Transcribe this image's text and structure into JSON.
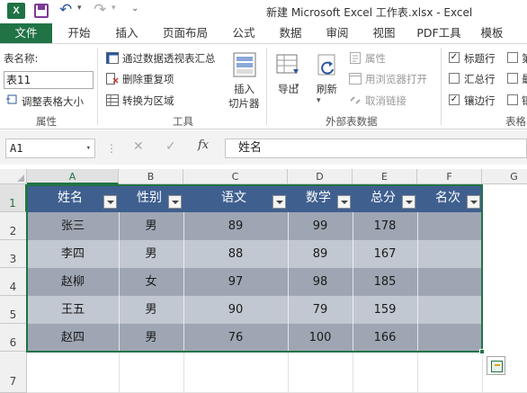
{
  "window": {
    "title": "新建 Microsoft Excel 工作表.xlsx - Excel",
    "app_logo": "X"
  },
  "quick_access": {
    "save_icon": "save-icon",
    "undo_glyph": "↶",
    "redo_glyph": "↷",
    "dropdown_glyph": "▾",
    "customize_glyph": "⌄"
  },
  "ribbon_tabs": [
    "文件",
    "开始",
    "插入",
    "页面布局",
    "公式",
    "数据",
    "审阅",
    "视图",
    "PDF工具",
    "模板"
  ],
  "ribbon": {
    "properties": {
      "table_name_label": "表名称:",
      "table_name_value": "表11",
      "resize_label": "调整表格大小",
      "group_label": "属性"
    },
    "tools": {
      "pivot_label": "通过数据透视表汇总",
      "remove_dup_label": "删除重复项",
      "convert_label": "转换为区域",
      "slicer_label_1": "插入",
      "slicer_label_2": "切片器",
      "group_label": "工具"
    },
    "external": {
      "export_label": "导出",
      "refresh_label": "刷新",
      "properties_label": "属性",
      "browser_label": "用浏览器打开",
      "unlink_label": "取消链接",
      "group_label": "外部表数据"
    },
    "style_options": {
      "header_row": {
        "label": "标题行",
        "checked": true
      },
      "total_row": {
        "label": "汇总行",
        "checked": false
      },
      "banded_rows": {
        "label": "镶边行",
        "checked": true
      },
      "first_col": {
        "label": "第",
        "checked": false
      },
      "last_col": {
        "label": "最",
        "checked": false
      },
      "banded_cols": {
        "label": "镶",
        "checked": false
      },
      "group_label": "表格"
    }
  },
  "formula_bar": {
    "name_box": "A1",
    "cancel_glyph": "✕",
    "enter_glyph": "✓",
    "fx_label": "fx",
    "content": "姓名"
  },
  "columns": [
    "A",
    "B",
    "C",
    "D",
    "E",
    "F",
    "G"
  ],
  "rows": [
    "1",
    "2",
    "3",
    "4",
    "5",
    "6",
    "7"
  ],
  "table": {
    "headers": [
      "姓名",
      "性别",
      "语文",
      "数学",
      "总分",
      "名次"
    ],
    "rows": [
      [
        "张三",
        "男",
        "89",
        "99",
        "178",
        ""
      ],
      [
        "李四",
        "男",
        "88",
        "89",
        "167",
        ""
      ],
      [
        "赵柳",
        "女",
        "97",
        "98",
        "185",
        ""
      ],
      [
        "王五",
        "男",
        "90",
        "79",
        "159",
        ""
      ],
      [
        "赵四",
        "男",
        "76",
        "100",
        "166",
        ""
      ]
    ]
  },
  "colors": {
    "excel_green": "#217346",
    "table_header": "#3f5f8f",
    "band_dark": "#9ea6b3",
    "band_light": "#c2c8d1"
  }
}
